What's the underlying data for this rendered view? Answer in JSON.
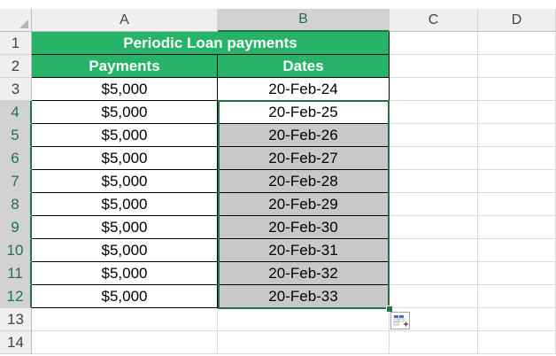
{
  "sheet": {
    "columns": [
      "A",
      "B",
      "C",
      "D"
    ],
    "selected_column": "B",
    "rows": [
      "1",
      "2",
      "3",
      "4",
      "5",
      "6",
      "7",
      "8",
      "9",
      "10",
      "11",
      "12",
      "13",
      "14"
    ],
    "title": "Periodic Loan payments",
    "headers": {
      "payments": "Payments",
      "dates": "Dates"
    },
    "data_rows": [
      {
        "payment": "$5,000",
        "date": "20-Feb-24"
      },
      {
        "payment": "$5,000",
        "date": "20-Feb-25"
      },
      {
        "payment": "$5,000",
        "date": "20-Feb-26"
      },
      {
        "payment": "$5,000",
        "date": "20-Feb-27"
      },
      {
        "payment": "$5,000",
        "date": "20-Feb-28"
      },
      {
        "payment": "$5,000",
        "date": "20-Feb-29"
      },
      {
        "payment": "$5,000",
        "date": "20-Feb-30"
      },
      {
        "payment": "$5,000",
        "date": "20-Feb-31"
      },
      {
        "payment": "$5,000",
        "date": "20-Feb-32"
      },
      {
        "payment": "$5,000",
        "date": "20-Feb-33"
      }
    ]
  },
  "selection": {
    "range": "B4:B12",
    "header_color": "#217346"
  },
  "table_header_color": "#27b367",
  "shaded_fill_color": "#c8c8c8",
  "quick_analysis_icon": "quick-analysis-icon"
}
